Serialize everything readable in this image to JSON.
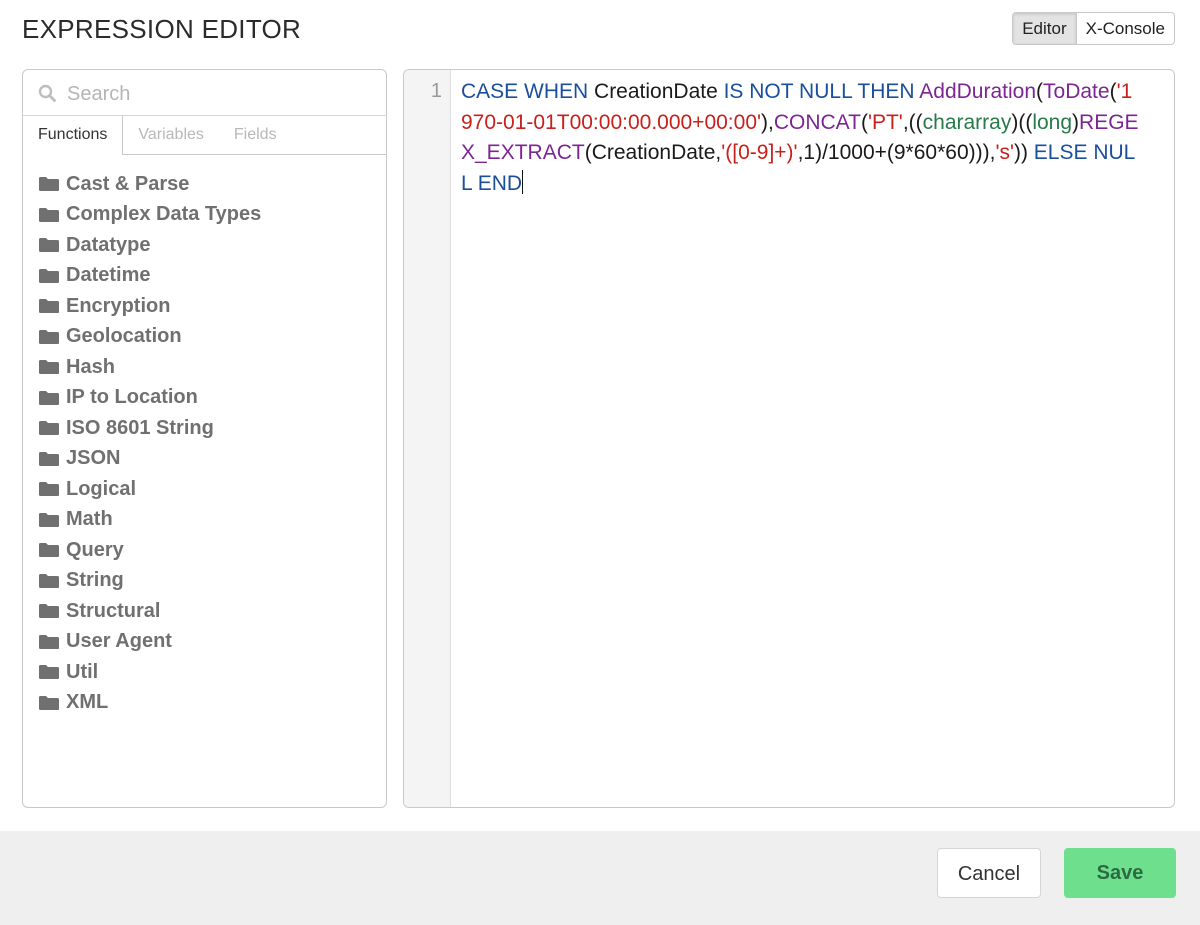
{
  "header": {
    "title": "EXPRESSION EDITOR",
    "modes": [
      {
        "label": "Editor",
        "active": true
      },
      {
        "label": "X-Console",
        "active": false
      }
    ]
  },
  "sidebar": {
    "search_placeholder": "Search",
    "tabs": [
      {
        "label": "Functions",
        "active": true
      },
      {
        "label": "Variables",
        "active": false
      },
      {
        "label": "Fields",
        "active": false
      }
    ],
    "folders": [
      "Cast & Parse",
      "Complex Data Types",
      "Datatype",
      "Datetime",
      "Encryption",
      "Geolocation",
      "Hash",
      "IP to Location",
      "ISO 8601 String",
      "JSON",
      "Logical",
      "Math",
      "Query",
      "String",
      "Structural",
      "User Agent",
      "Util",
      "XML"
    ]
  },
  "editor": {
    "line_number": "1",
    "tokens": [
      {
        "t": "CASE WHEN",
        "c": "kw"
      },
      {
        "t": " CreationDate ",
        "c": "plain"
      },
      {
        "t": "IS NOT NULL THEN",
        "c": "kw"
      },
      {
        "t": " ",
        "c": "plain"
      },
      {
        "t": "AddDuration",
        "c": "fn"
      },
      {
        "t": "(",
        "c": "plain"
      },
      {
        "t": "ToDate",
        "c": "fn"
      },
      {
        "t": "(",
        "c": "plain"
      },
      {
        "t": "'1970-01-01T00:00:00.000+00:00'",
        "c": "str"
      },
      {
        "t": "),",
        "c": "plain"
      },
      {
        "t": "CONCAT",
        "c": "fn"
      },
      {
        "t": "(",
        "c": "plain"
      },
      {
        "t": "'PT'",
        "c": "str"
      },
      {
        "t": ",((",
        "c": "plain"
      },
      {
        "t": "chararray",
        "c": "ty"
      },
      {
        "t": ")((",
        "c": "plain"
      },
      {
        "t": "long",
        "c": "ty"
      },
      {
        "t": ")",
        "c": "plain"
      },
      {
        "t": "REGEX_EXTRACT",
        "c": "fn"
      },
      {
        "t": "(CreationDate,",
        "c": "plain"
      },
      {
        "t": "'([0-9]+)'",
        "c": "str"
      },
      {
        "t": ",1)/1000+(9*60*60))),",
        "c": "plain"
      },
      {
        "t": "'s'",
        "c": "str"
      },
      {
        "t": ")) ",
        "c": "plain"
      },
      {
        "t": "ELSE NULL END",
        "c": "kw"
      }
    ]
  },
  "footer": {
    "cancel_label": "Cancel",
    "save_label": "Save"
  },
  "colors": {
    "keyword": "#1a4f9c",
    "function": "#7d2593",
    "string": "#c8201b",
    "type": "#287a4a",
    "save_button": "#6ee08d"
  }
}
